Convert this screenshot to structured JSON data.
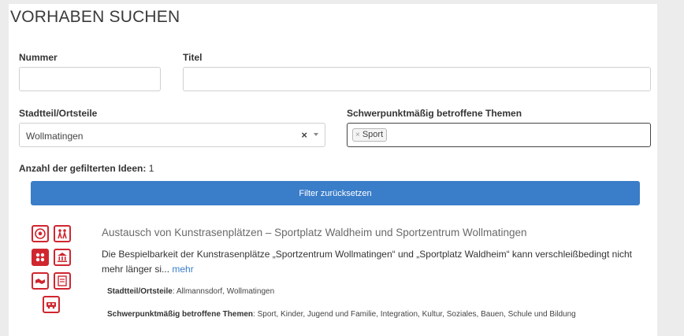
{
  "heading": "VORHABEN SUCHEN",
  "filters": {
    "nummer_label": "Nummer",
    "nummer_value": "",
    "titel_label": "Titel",
    "titel_value": "",
    "stadtteil_label": "Stadtteil/Ortsteile",
    "stadtteil_value": "Wollmatingen",
    "clear_symbol": "×",
    "themen_label": "Schwerpunktmäßig betroffene Themen",
    "themen_tags": [
      "Sport"
    ],
    "tag_remove_symbol": "×"
  },
  "count": {
    "label": "Anzahl der gefilterten Ideen:",
    "value": "1"
  },
  "reset_button": "Filter zurücksetzen",
  "results": [
    {
      "title": "Austausch von Kunstrasenplätzen – Sportplatz Waldheim und Sportzentrum Wollmatingen",
      "description": "Die Bespielbarkeit der Kunstrasenplätze „Sportzentrum Wollmatingen“ und „Sportplatz Waldheim“ kann verschleißbedingt nicht mehr länger si...",
      "more_link": "mehr",
      "stadtteil_label": "Stadtteil/Ortsteile",
      "stadtteil_value": "Allmannsdorf, Wollmatingen",
      "themen_label": "Schwerpunktmäßig betroffene Themen",
      "themen_value": "Sport, Kinder, Jugend und Familie, Integration, Kultur, Soziales, Bauen, Schule und Bildung",
      "theme_icons": [
        "sport-ball-icon",
        "children-icon",
        "family-icon",
        "culture-building-icon",
        "integration-handshake-icon",
        "social-document-icon",
        "school-bus-icon"
      ]
    }
  ],
  "colors": {
    "accent": "#3a7dc9",
    "icon_red": "#d0262f"
  }
}
